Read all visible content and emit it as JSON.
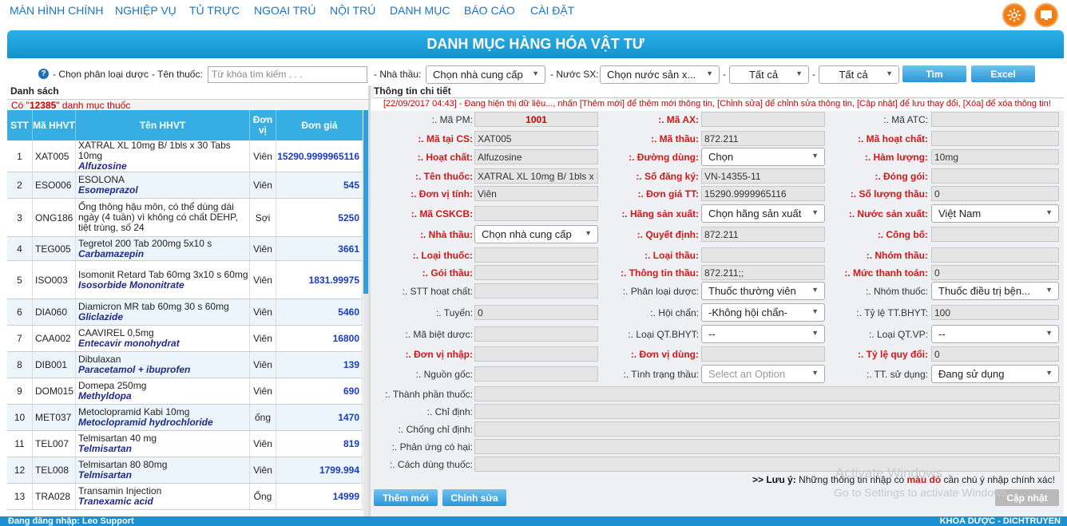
{
  "nav": {
    "items": [
      "MÀN HÌNH CHÍNH",
      "NGHIỆP VỤ",
      "TỦ TRỰC",
      "NGOẠI TRÚ",
      "NỘI TRÚ",
      "DANH MỤC",
      "BÁO CÁO",
      "CÀI ĐẶT"
    ],
    "settings_icon": "gear-icon",
    "screen_icon": "monitor-icon"
  },
  "page_title": "DANH MỤC HÀNG HÓA VẬT TƯ",
  "filter": {
    "phan_loai_label": "- Chọn phân loại dược",
    "ten_thuoc_label": "- Tên thuốc:",
    "ten_thuoc_placeholder": "Từ khóa tìm kiếm . . .",
    "nha_thau_label": "- Nhà thầu:",
    "nha_thau_value": "Chọn nhà cung cấp",
    "nuoc_sx_label": "- Nước SX:",
    "nuoc_sx_value": "Chọn nước sản x...",
    "dash1": "-",
    "tat_ca_1": "Tất cả",
    "dash2": "-",
    "tat_ca_2": "Tất cả",
    "search_button": "Tìm",
    "excel_button": "Excel"
  },
  "list": {
    "title": "Danh sách",
    "count_prefix": "Có \"",
    "count": "12385",
    "count_suffix": "\" danh mục thuốc",
    "headers": {
      "stt": "STT",
      "ma": "Mã HHVT",
      "ten": "Tên HHVT",
      "dv": "Đơn vị",
      "gia": "Đơn giá"
    },
    "rows": [
      {
        "stt": "1",
        "ma": "XAT005",
        "ten": "XATRAL XL 10mg B/ 1bls x 30 Tabs 10mg",
        "generic": "Alfuzosine",
        "dv": "Viên",
        "gia": "15290.9999965116"
      },
      {
        "stt": "2",
        "ma": "ESO006",
        "ten": "ESOLONA",
        "generic": "Esomeprazol",
        "dv": "Viên",
        "gia": "545"
      },
      {
        "stt": "3",
        "ma": "ONG186",
        "ten": "Ống thông hậu môn, có thể dùng dài ngày (4 tuần) vì không có chất DEHP, tiệt trùng, số 24",
        "generic": "",
        "dv": "Sợi",
        "gia": "5250"
      },
      {
        "stt": "4",
        "ma": "TEG005",
        "ten": "Tegretol 200 Tab 200mg 5x10 s",
        "generic": "Carbamazepin",
        "dv": "Viên",
        "gia": "3661"
      },
      {
        "stt": "5",
        "ma": "ISO003",
        "ten": "Isomonit Retard Tab 60mg 3x10 s 60mg",
        "generic": "Isosorbide Mononitrate",
        "dv": "Viên",
        "gia": "1831.99975"
      },
      {
        "stt": "6",
        "ma": "DIA060",
        "ten": "Diamicron MR tab 60mg 30 s 60mg",
        "generic": "Gliclazide",
        "dv": "Viên",
        "gia": "5460"
      },
      {
        "stt": "7",
        "ma": "CAA002",
        "ten": "CAAVIREL 0,5mg",
        "generic": "Entecavir monohydrat",
        "dv": "Viên",
        "gia": "16800"
      },
      {
        "stt": "8",
        "ma": "DIB001",
        "ten": "Dibulaxan",
        "generic": "Paracetamol + ibuprofen",
        "dv": "Viên",
        "gia": "139"
      },
      {
        "stt": "9",
        "ma": "DOM015",
        "ten": "Domepa 250mg",
        "generic": "Methyldopa",
        "dv": "Viên",
        "gia": "690"
      },
      {
        "stt": "10",
        "ma": "MET037",
        "ten": "Metoclopramid Kabi 10mg",
        "generic": "Metoclopramid hydrochloride",
        "dv": "ống",
        "gia": "1470"
      },
      {
        "stt": "11",
        "ma": "TEL007",
        "ten": "Telmisartan 40 mg",
        "generic": "Telmisartan",
        "dv": "Viên",
        "gia": "819"
      },
      {
        "stt": "12",
        "ma": "TEL008",
        "ten": "Telmisartan 80 80mg",
        "generic": "Telmisartan",
        "dv": "Viên",
        "gia": "1799.994"
      },
      {
        "stt": "13",
        "ma": "TRA028",
        "ten": "Transamin Injection",
        "generic": "Tranexamic acid",
        "dv": "Ống",
        "gia": "14999"
      }
    ]
  },
  "detail": {
    "title": "Thông tin chi tiết",
    "info_line": "[22/09/2017 04:43] - Đang hiện thị dữ liệu..., nhấn [Thêm mới] để thêm mới thông tin, [Chỉnh sửa] để chỉnh sửa thông tin, [Cập nhật] để lưu thay đổi, [Xóa] để xóa thông tin!",
    "fields": {
      "ma_pm": {
        "label": ":. Mã PM:",
        "value": "1001"
      },
      "ma_ax": {
        "label": ":. Mã AX:",
        "value": ""
      },
      "ma_atc": {
        "label": ":. Mã ATC:",
        "value": ""
      },
      "ma_tai_cs": {
        "label": ":. Mã tại CS:",
        "value": "XAT005"
      },
      "ma_thau": {
        "label": ":. Mã thầu:",
        "value": "872.211"
      },
      "ma_hoat_chat": {
        "label": ":. Mã hoạt chất:",
        "value": ""
      },
      "hoat_chat": {
        "label": ":. Hoạt chất:",
        "value": "Alfuzosine"
      },
      "duong_dung": {
        "label": ":. Đường dùng:",
        "value": "Chọn"
      },
      "ham_luong": {
        "label": ":. Hàm lượng:",
        "value": "10mg"
      },
      "ten_thuoc": {
        "label": ":. Tên thuốc:",
        "value": "XATRAL XL 10mg B/ 1bls x 3"
      },
      "so_dang_ky": {
        "label": ":. Số đăng ký:",
        "value": "VN-14355-11"
      },
      "dong_goi": {
        "label": ":. Đóng gói:",
        "value": ""
      },
      "don_vi_tinh": {
        "label": ":. Đơn vị tính:",
        "value": "Viên"
      },
      "don_gia_tt": {
        "label": ":. Đơn giá TT:",
        "value": "15290.9999965116"
      },
      "so_luong_thau": {
        "label": ":. Số lượng thầu:",
        "value": "0"
      },
      "ma_cskcb": {
        "label": ":. Mã CSKCB:",
        "value": ""
      },
      "hang_sx": {
        "label": ":. Hãng sản xuất:",
        "value": "Chọn hãng sản xuất"
      },
      "nuoc_sx": {
        "label": ":. Nước sản xuất:",
        "value": "Việt Nam"
      },
      "nha_thau": {
        "label": ":. Nhà thầu:",
        "value": "Chọn nhà cung cấp"
      },
      "quyet_dinh": {
        "label": ":. Quyết định:",
        "value": "872.211"
      },
      "cong_bo": {
        "label": ":. Công bố:",
        "value": ""
      },
      "loai_thuoc": {
        "label": ":. Loại thuốc:",
        "value": ""
      },
      "loai_thau": {
        "label": ":. Loại thầu:",
        "value": ""
      },
      "nhom_thau": {
        "label": ":. Nhóm thầu:",
        "value": ""
      },
      "goi_thau": {
        "label": ":. Gói thầu:",
        "value": ""
      },
      "thong_tin_thau": {
        "label": ":. Thông tin thầu:",
        "value": "872.211;;"
      },
      "muc_thanh_toan": {
        "label": ":. Mức thanh toán:",
        "value": "0"
      },
      "stt_hoat_chat": {
        "label": ":. STT hoạt chất:",
        "value": ""
      },
      "phan_loai_duoc": {
        "label": ":. Phân loại dược:",
        "value": "Thuốc thường viên"
      },
      "nhom_thuoc": {
        "label": ":. Nhóm thuốc:",
        "value": "Thuốc điều trị bện..."
      },
      "tuyen": {
        "label": ":. Tuyến:",
        "value": "0"
      },
      "hoi_chan": {
        "label": ":. Hội chẩn:",
        "value": "-Không hội chẩn-"
      },
      "ty_le_bhyt": {
        "label": ":. Tỷ lệ TT.BHYT:",
        "value": "100"
      },
      "ma_biet_duoc": {
        "label": ":. Mã biệt dược:",
        "value": ""
      },
      "loai_qt_bhyt": {
        "label": ":. Loại QT.BHYT:",
        "value": "--"
      },
      "loai_qt_vp": {
        "label": ":. Loại QT.VP:",
        "value": "--"
      },
      "don_vi_nhap": {
        "label": ":. Đơn vị nhập:",
        "value": ""
      },
      "don_vi_dung": {
        "label": ":. Đơn vị dùng:",
        "value": ""
      },
      "ty_le_quy_doi": {
        "label": ":. Tỷ lệ quy đổi:",
        "value": "0"
      },
      "nguon_goc": {
        "label": ":. Nguồn gốc:",
        "value": ""
      },
      "tinh_trang_thau": {
        "label": ":. Tình trạng thầu:",
        "value": "Select an Option"
      },
      "tt_su_dung": {
        "label": ":. TT. sử dụng:",
        "value": "Đang sử dụng"
      },
      "thanh_phan": {
        "label": ":. Thành phần thuốc:"
      },
      "chi_dinh": {
        "label": ":. Chỉ định:"
      },
      "chong_chi_dinh": {
        "label": ":. Chống chỉ định:"
      },
      "phan_ung": {
        "label": ":. Phản ứng có hại:"
      },
      "cach_dung": {
        "label": ":. Cách dùng thuốc:"
      }
    },
    "note_prefix": ">> Lưu ý:",
    "note_mid": " Những thông tin nhập có ",
    "note_red": "màu đỏ",
    "note_suffix": " cần chú ý nhập chính xác!",
    "add_button": "Thêm mới",
    "edit_button": "Chỉnh sửa",
    "update_button": "Cập nhật"
  },
  "status": {
    "login": "Đang đăng nhập: Leo Support",
    "dept": "KHOA DƯỢC - DICHTRUYEN"
  },
  "watermark": {
    "line1": "Activate Windows",
    "line2": "Go to Settings to activate Windows."
  }
}
